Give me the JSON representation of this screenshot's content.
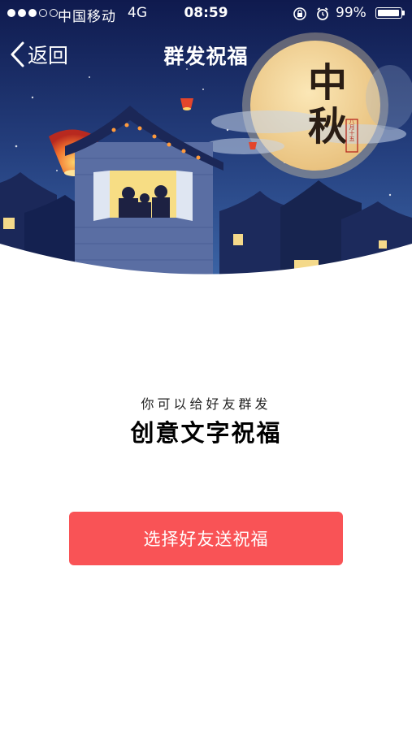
{
  "status_bar": {
    "signal_total": 5,
    "signal_filled": 3,
    "carrier": "中国移动",
    "network": "4G",
    "time": "08:59",
    "battery_text": "99%",
    "battery_level": 0.99,
    "icons": [
      "signal-dots-icon",
      "orientation-lock-icon",
      "alarm-icon",
      "battery-icon"
    ]
  },
  "nav": {
    "back_label": "返回",
    "title": "群发祝福"
  },
  "hero": {
    "calligraphy": "中秋",
    "seal_text": "八月十五"
  },
  "main": {
    "subtitle": "你可以给好友群发",
    "headline": "创意文字祝福",
    "button_label": "选择好友送祝福"
  },
  "colors": {
    "accent": "#f95356",
    "sky_top": "#0f1a4e",
    "sky_bottom": "#3c65a6",
    "moon": "#f3d79b",
    "text_dark": "#222222"
  }
}
